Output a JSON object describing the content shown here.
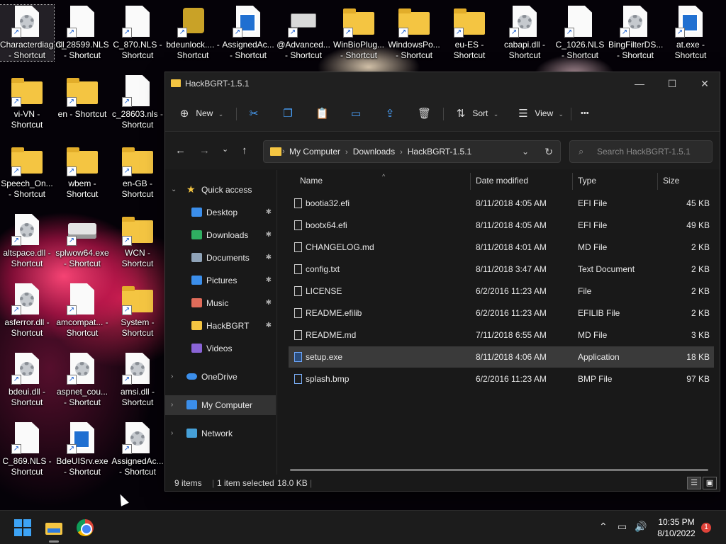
{
  "desktop": {
    "icons": [
      {
        "label": "Characterdiag.dll - Shortcut",
        "type": "gear"
      },
      {
        "label": "C_28599.NLS - Shortcut",
        "type": "file"
      },
      {
        "label": "C_870.NLS - Shortcut",
        "type": "file"
      },
      {
        "label": "bdeunlock.... - Shortcut",
        "type": "lock"
      },
      {
        "label": "AssignedAc... - Shortcut",
        "type": "blue"
      },
      {
        "label": "@Advanced... - Shortcut",
        "type": "keyboard"
      },
      {
        "label": "WinBioPlug... - Shortcut",
        "type": "folder"
      },
      {
        "label": "WindowsPo... - Shortcut",
        "type": "folder"
      },
      {
        "label": "eu-ES - Shortcut",
        "type": "folder"
      },
      {
        "label": "cabapi.dll - Shortcut",
        "type": "gear"
      },
      {
        "label": "C_1026.NLS - Shortcut",
        "type": "file"
      },
      {
        "label": "BingFilterDS... - Shortcut",
        "type": "gear"
      },
      {
        "label": "at.exe - Shortcut",
        "type": "blue"
      },
      {
        "label": "vi-VN - Shortcut",
        "type": "folder"
      },
      {
        "label": "en - Shortcut",
        "type": "folder"
      },
      {
        "label": "c_28603.nls - Shortcut",
        "type": "file"
      },
      {
        "label": "Speech_On... - Shortcut",
        "type": "folder"
      },
      {
        "label": "wbem - Shortcut",
        "type": "folder"
      },
      {
        "label": "en-GB - Shortcut",
        "type": "folder"
      },
      {
        "label": "altspace.dll - Shortcut",
        "type": "gear"
      },
      {
        "label": "splwow64.exe - Shortcut",
        "type": "printer"
      },
      {
        "label": "WCN - Shortcut",
        "type": "folder"
      },
      {
        "label": "asferror.dll - Shortcut",
        "type": "gear"
      },
      {
        "label": "amcompat... - Shortcut",
        "type": "file"
      },
      {
        "label": "System - Shortcut",
        "type": "folder"
      },
      {
        "label": "bdeui.dll - Shortcut",
        "type": "gear"
      },
      {
        "label": "aspnet_cou... - Shortcut",
        "type": "gear"
      },
      {
        "label": "amsi.dll - Shortcut",
        "type": "gear"
      },
      {
        "label": "C_869.NLS - Shortcut",
        "type": "file"
      },
      {
        "label": "BdeUISrv.exe - Shortcut",
        "type": "blue"
      },
      {
        "label": "AssignedAc... - Shortcut",
        "type": "gear"
      }
    ]
  },
  "window": {
    "title": "HackBGRT-1.5.1",
    "controls": {
      "minimize": "—",
      "maximize": "☐",
      "close": "✕"
    }
  },
  "toolbar": {
    "new_label": "New",
    "sort_label": "Sort",
    "view_label": "View",
    "more_label": "•••"
  },
  "address": {
    "crumbs": [
      "My Computer",
      "Downloads",
      "HackBGRT-1.5.1"
    ],
    "search_placeholder": "Search HackBGRT-1.5.1"
  },
  "nav": {
    "quick_access": "Quick access",
    "items": [
      {
        "label": "Desktop",
        "color": "#3b8eea"
      },
      {
        "label": "Downloads",
        "color": "#2fae61"
      },
      {
        "label": "Documents",
        "color": "#8fa3b8"
      },
      {
        "label": "Pictures",
        "color": "#3b8eea"
      },
      {
        "label": "Music",
        "color": "#e06c5a"
      },
      {
        "label": "HackBGRT",
        "color": "#f4c542"
      },
      {
        "label": "Videos",
        "color": "#8a64d6"
      }
    ],
    "onedrive": "OneDrive",
    "this_pc": "My Computer",
    "network": "Network"
  },
  "filelist": {
    "columns": [
      "Name",
      "Date modified",
      "Type",
      "Size"
    ],
    "rows": [
      {
        "name": "bootia32.efi",
        "date": "8/11/2018 4:05 AM",
        "type": "EFI File",
        "size": "45 KB"
      },
      {
        "name": "bootx64.efi",
        "date": "8/11/2018 4:05 AM",
        "type": "EFI File",
        "size": "49 KB"
      },
      {
        "name": "CHANGELOG.md",
        "date": "8/11/2018 4:01 AM",
        "type": "MD File",
        "size": "2 KB"
      },
      {
        "name": "config.txt",
        "date": "8/11/2018 3:47 AM",
        "type": "Text Document",
        "size": "2 KB"
      },
      {
        "name": "LICENSE",
        "date": "6/2/2016 11:23 AM",
        "type": "File",
        "size": "2 KB"
      },
      {
        "name": "README.efilib",
        "date": "6/2/2016 11:23 AM",
        "type": "EFILIB File",
        "size": "2 KB"
      },
      {
        "name": "README.md",
        "date": "7/11/2018 6:55 AM",
        "type": "MD File",
        "size": "3 KB"
      },
      {
        "name": "setup.exe",
        "date": "8/11/2018 4:06 AM",
        "type": "Application",
        "size": "18 KB",
        "selected": true
      },
      {
        "name": "splash.bmp",
        "date": "6/2/2016 11:23 AM",
        "type": "BMP File",
        "size": "97 KB"
      }
    ]
  },
  "status": {
    "count": "9 items",
    "selection": "1 item selected",
    "size": "18.0 KB"
  },
  "taskbar": {
    "time": "10:35 PM",
    "date": "8/10/2022",
    "notifications": "1"
  }
}
